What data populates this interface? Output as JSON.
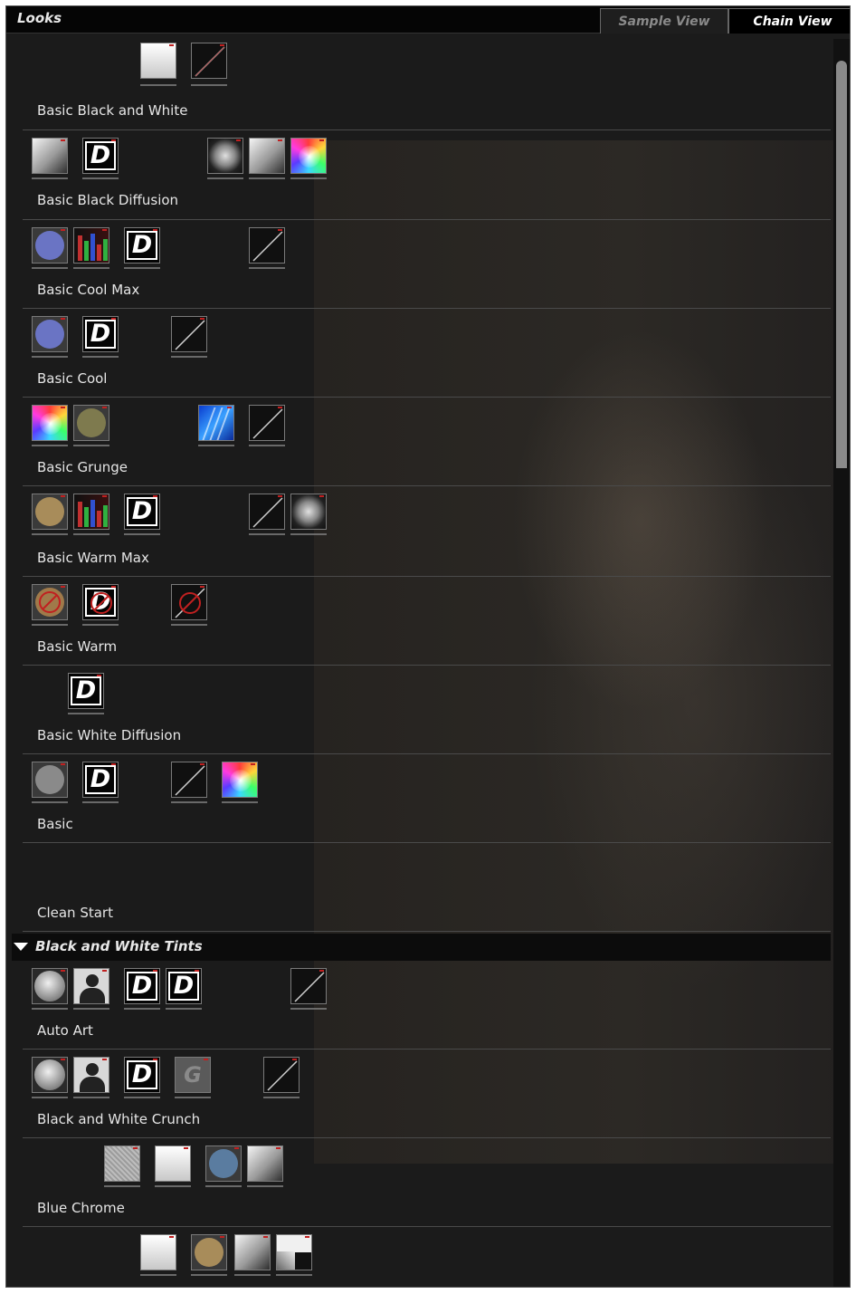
{
  "panel": {
    "title": "Looks",
    "tabs": [
      {
        "label": "Sample View",
        "active": false
      },
      {
        "label": "Chain View",
        "active": true
      }
    ]
  },
  "looks": [
    {
      "name": "Basic Black and White",
      "tools": [
        "black-white",
        "curves"
      ]
    },
    {
      "name": "Basic Black Diffusion",
      "tools": [
        "contrast",
        "diffusion",
        "vignette-dial",
        "contrast",
        "saturation-wheel"
      ]
    },
    {
      "name": "Basic Cool Max",
      "tools": [
        "mono-tint-blue",
        "ranged-saturation",
        "diffusion",
        "curves"
      ]
    },
    {
      "name": "Basic Cool",
      "tools": [
        "mono-tint-blue",
        "diffusion",
        "curves"
      ]
    },
    {
      "name": "Basic Grunge",
      "tools": [
        "saturation-wheel",
        "mono-tint-olive",
        "film-grain",
        "curves"
      ]
    },
    {
      "name": "Basic Warm Max",
      "tools": [
        "mono-tint-tan",
        "ranged-saturation",
        "diffusion",
        "curves",
        "vignette-dial"
      ]
    },
    {
      "name": "Basic Warm",
      "tools": [
        "mono-tint-disabled",
        "diffusion-disabled",
        "curves-disabled"
      ]
    },
    {
      "name": "Basic White Diffusion",
      "tools": [
        "diffusion"
      ]
    },
    {
      "name": "Basic",
      "tools": [
        "mono-tint-gray",
        "diffusion",
        "curves",
        "saturation-wheel"
      ]
    },
    {
      "name": "Clean Start",
      "tools": []
    }
  ],
  "category": {
    "label": "Black and White Tints",
    "expanded": true,
    "looks": [
      {
        "name": "Auto Art",
        "tools": [
          "saturation",
          "hi-light",
          "diffusion",
          "diffusion",
          "curves"
        ]
      },
      {
        "name": "Black and White Crunch",
        "tools": [
          "saturation",
          "hi-light",
          "diffusion",
          "grain-disabled",
          "curves"
        ]
      },
      {
        "name": "Blue Chrome",
        "tools": [
          "vignette-noise",
          "black-white",
          "mono-tint-blue",
          "contrast"
        ]
      },
      {
        "name": "",
        "tools": [
          "black-white",
          "mono-tint-tan",
          "contrast",
          "split-tone"
        ]
      }
    ]
  },
  "colors": {
    "panel_bg": "#1b1b1b",
    "titlebar_bg": "#050505",
    "text": "#e6e6e6",
    "separator": "#4a4a4a",
    "tile_marker": "#c02020",
    "mono_blue": "#6a74c4",
    "mono_olive": "#7e7a4e",
    "mono_tan": "#a88c5a",
    "mono_gray": "#8a8a8a"
  }
}
